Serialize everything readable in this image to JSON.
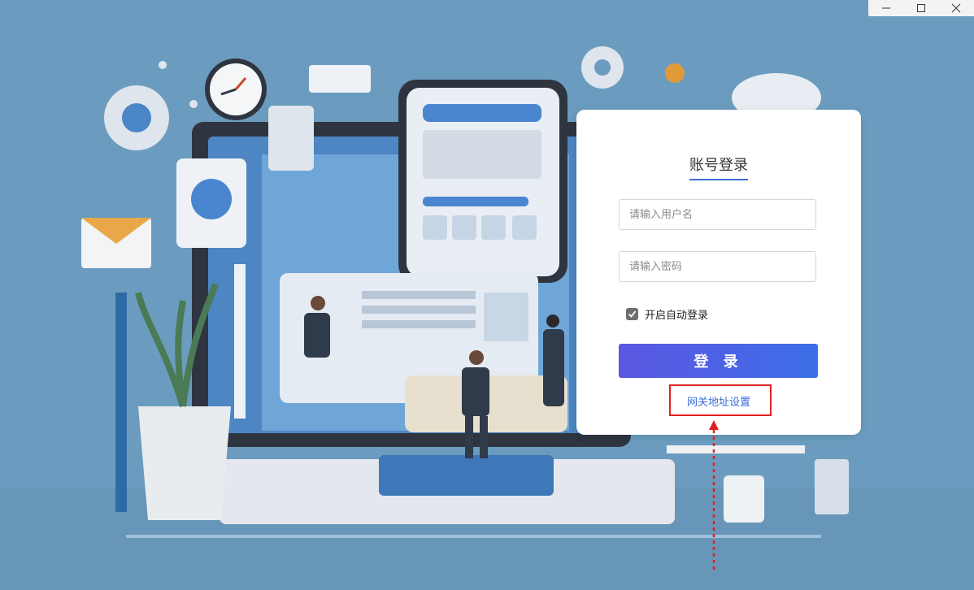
{
  "window": {
    "minimize": "minimize",
    "maximize": "maximize",
    "close": "close"
  },
  "login": {
    "title": "账号登录",
    "username_placeholder": "请输入用户名",
    "password_placeholder": "请输入密码",
    "auto_login_label": "开启自动登录",
    "auto_login_checked": true,
    "submit_label": "登 录",
    "gateway_link": "网关地址设置"
  },
  "colors": {
    "background": "#6b9cbf",
    "accent": "#3b6fd8",
    "button_gradient_start": "#5a57e0",
    "button_gradient_end": "#3b6fe6",
    "annotation": "#e02020"
  }
}
